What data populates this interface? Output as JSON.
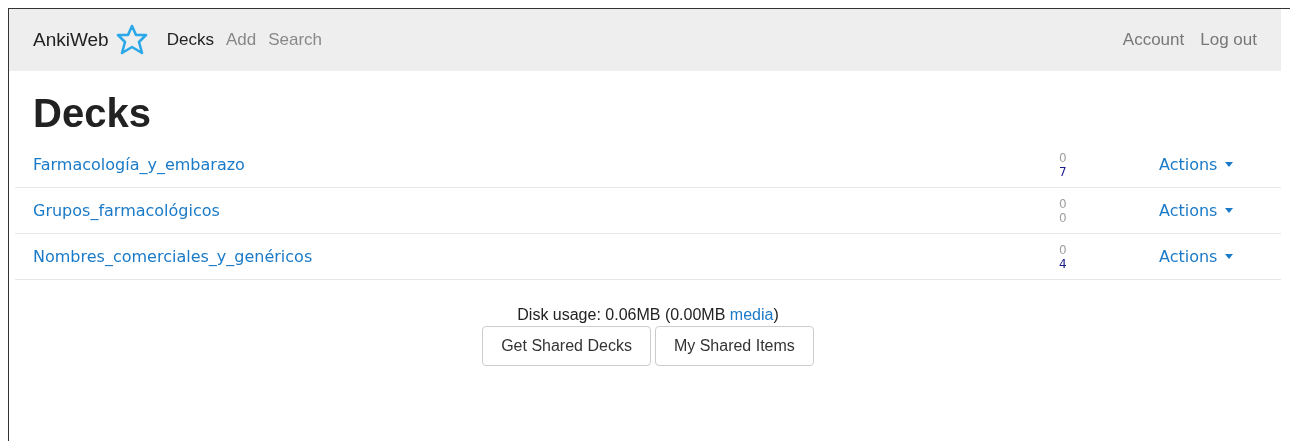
{
  "navbar": {
    "brand": "AnkiWeb",
    "links": [
      {
        "label": "Decks",
        "selected": true
      },
      {
        "label": "Add",
        "selected": false
      },
      {
        "label": "Search",
        "selected": false
      }
    ],
    "right_links": [
      "Account",
      "Log out"
    ]
  },
  "heading": "Decks",
  "decks": [
    {
      "name": "Farmacología_y_embarazo",
      "counts": [
        {
          "value": "0",
          "color": "#a0a0a0"
        },
        {
          "value": "7",
          "color": "#1a1a8c"
        }
      ],
      "action": "Actions"
    },
    {
      "name": "Grupos_farmacológicos",
      "counts": [
        {
          "value": "0",
          "color": "#a0a0a0"
        },
        {
          "value": "0",
          "color": "#a0a0a0"
        }
      ],
      "action": "Actions"
    },
    {
      "name": "Nombres_comerciales_y_genéricos",
      "counts": [
        {
          "value": "0",
          "color": "#a0a0a0"
        },
        {
          "value": "4",
          "color": "#1a1a8c"
        }
      ],
      "action": "Actions"
    }
  ],
  "disk_usage": {
    "text": "Disk usage: 0.06MB (0.00MB",
    "link": "media",
    "close": ")"
  },
  "buttons": [
    "Get Shared Decks",
    "My Shared Items"
  ]
}
